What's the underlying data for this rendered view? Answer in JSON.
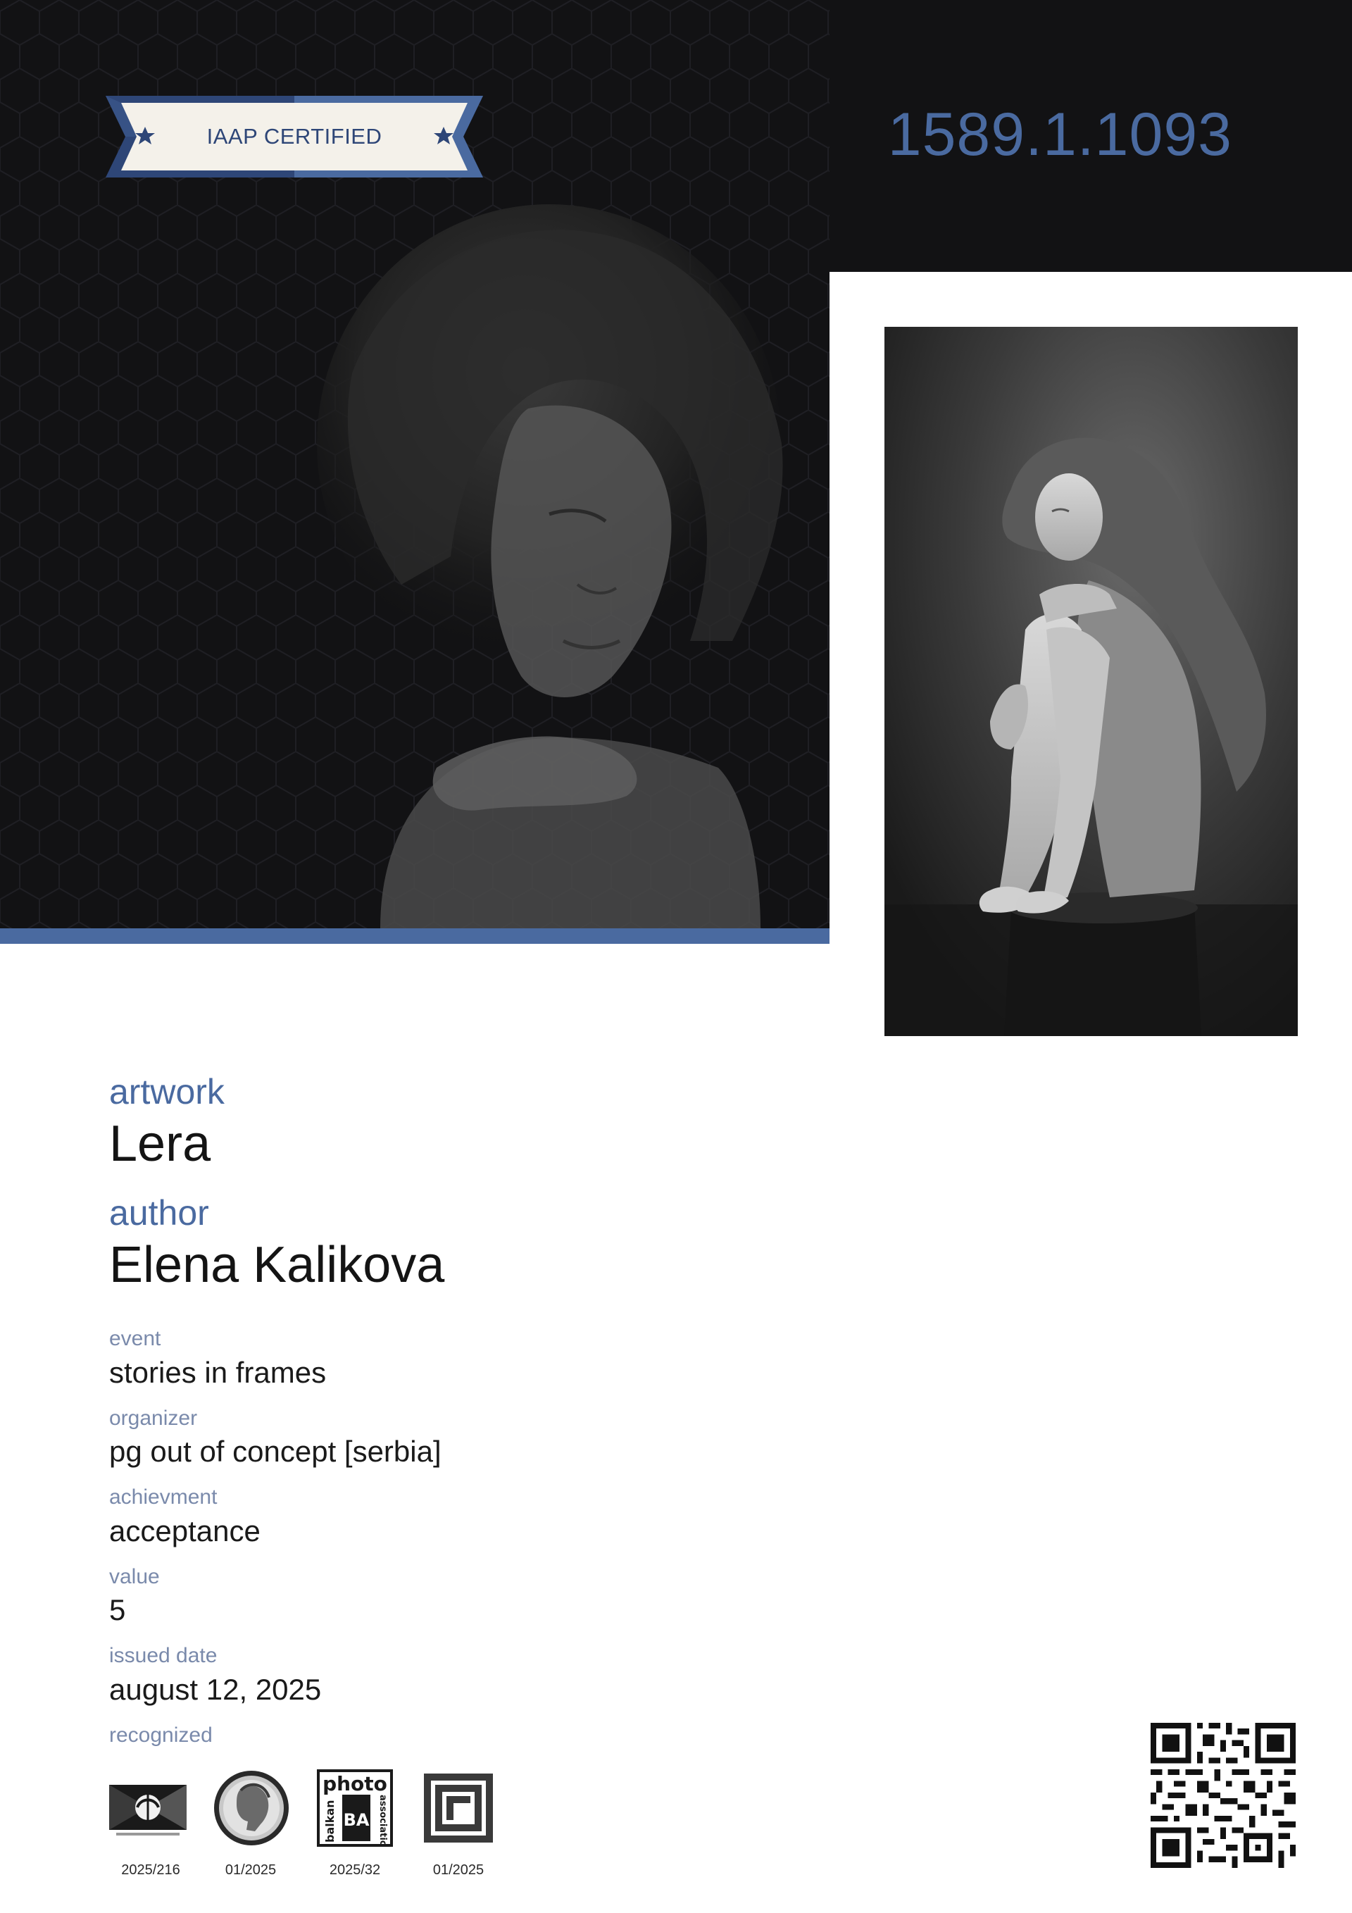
{
  "badge": {
    "label": "IAAP CERTIFIED",
    "star_icon": "star-icon"
  },
  "certificate": {
    "number": "1589.1.1093"
  },
  "colors": {
    "accent": "#4a6aa0",
    "dark_background": "#121214",
    "badge_navy": "#2e4677",
    "label_muted": "#7a8aab"
  },
  "artwork": {
    "label": "artwork",
    "value": "Lera"
  },
  "author": {
    "label": "author",
    "value": "Elena Kalikova"
  },
  "details": [
    {
      "label": "event",
      "value": "stories in frames"
    },
    {
      "label": "organizer",
      "value": "pg out of concept [serbia]"
    },
    {
      "label": "achievment",
      "value": "acceptance"
    },
    {
      "label": "value",
      "value": "5"
    },
    {
      "label": "issued date",
      "value": "august 12, 2025"
    }
  ],
  "recognized": {
    "label": "recognized",
    "logos": [
      {
        "icon": "iaap-logo",
        "code": "2025/216"
      },
      {
        "icon": "medal-head-logo",
        "code": "01/2025"
      },
      {
        "icon": "balkan-photo-association-logo",
        "code": "2025/32",
        "logo_text": [
          "photo",
          "balkan",
          "association"
        ]
      },
      {
        "icon": "square-frame-logo",
        "code": "01/2025"
      }
    ]
  },
  "qr_code": {
    "icon": "qr-code-icon"
  }
}
